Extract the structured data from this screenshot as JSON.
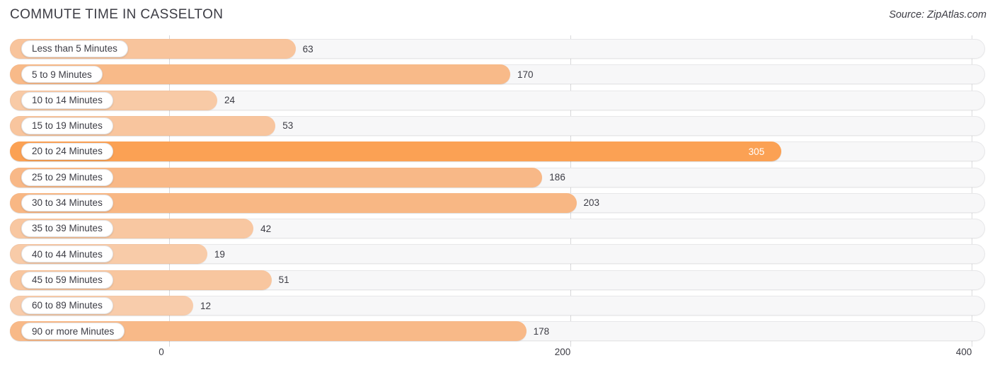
{
  "header": {
    "title": "COMMUTE TIME IN CASSELTON",
    "source": "Source: ZipAtlas.com"
  },
  "style": {
    "bar_color_normal": "#f9b179",
    "bar_color_highlight": "#fba154",
    "track_color": "#f7f7f8",
    "grid_color": "#d8d8da",
    "text_color": "#3c3c44"
  },
  "chart_data": {
    "type": "bar",
    "orientation": "horizontal",
    "title": "COMMUTE TIME IN CASSELTON",
    "subtitle": "",
    "xlabel": "",
    "ylabel": "",
    "xlim": [
      0,
      400
    ],
    "xticks": [
      "0",
      "200",
      "400"
    ],
    "xtick_values": [
      0,
      200,
      400
    ],
    "grid": true,
    "legend": false,
    "categories": [
      "Less than 5 Minutes",
      "5 to 9 Minutes",
      "10 to 14 Minutes",
      "15 to 19 Minutes",
      "20 to 24 Minutes",
      "25 to 29 Minutes",
      "30 to 34 Minutes",
      "35 to 39 Minutes",
      "40 to 44 Minutes",
      "45 to 59 Minutes",
      "60 to 89 Minutes",
      "90 or more Minutes"
    ],
    "values": [
      63,
      170,
      24,
      53,
      305,
      186,
      203,
      42,
      19,
      51,
      12,
      178
    ],
    "value_labels": [
      "63",
      "170",
      "24",
      "53",
      "305",
      "186",
      "203",
      "42",
      "19",
      "51",
      "12",
      "178"
    ],
    "max_value": 305,
    "highlight_index": 4
  },
  "rows": [
    {
      "label": "Less than 5 Minutes",
      "value": 63,
      "display": "63",
      "inside": false
    },
    {
      "label": "5 to 9 Minutes",
      "value": 170,
      "display": "170",
      "inside": false
    },
    {
      "label": "10 to 14 Minutes",
      "value": 24,
      "display": "24",
      "inside": false
    },
    {
      "label": "15 to 19 Minutes",
      "value": 53,
      "display": "53",
      "inside": false
    },
    {
      "label": "20 to 24 Minutes",
      "value": 305,
      "display": "305",
      "inside": true
    },
    {
      "label": "25 to 29 Minutes",
      "value": 186,
      "display": "186",
      "inside": false
    },
    {
      "label": "30 to 34 Minutes",
      "value": 203,
      "display": "203",
      "inside": false
    },
    {
      "label": "35 to 39 Minutes",
      "value": 42,
      "display": "42",
      "inside": false
    },
    {
      "label": "40 to 44 Minutes",
      "value": 19,
      "display": "19",
      "inside": false
    },
    {
      "label": "45 to 59 Minutes",
      "value": 51,
      "display": "51",
      "inside": false
    },
    {
      "label": "60 to 89 Minutes",
      "value": 12,
      "display": "12",
      "inside": false
    },
    {
      "label": "90 or more Minutes",
      "value": 178,
      "display": "178",
      "inside": false
    }
  ],
  "axis": {
    "ticks": [
      {
        "label": "0",
        "value": 0
      },
      {
        "label": "200",
        "value": 200
      },
      {
        "label": "400",
        "value": 400
      }
    ]
  }
}
